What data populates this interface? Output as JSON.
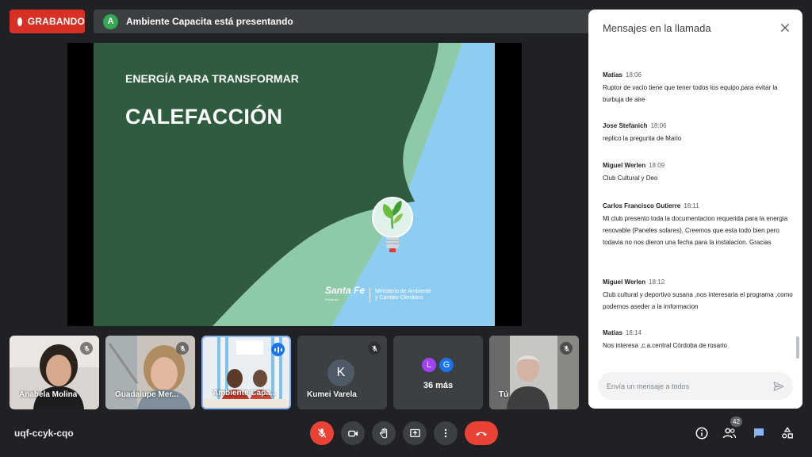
{
  "recording": {
    "label": "GRABANDO"
  },
  "presenting": {
    "avatar": "A",
    "text": "Ambiente Capacita está presentando",
    "avatar_color": "#34a853"
  },
  "slide": {
    "kicker": "ENERGÍA PARA TRANSFORMAR",
    "title": "CALEFACCIÓN",
    "brand": "Santa Fe",
    "brand_sub": "Provincia",
    "ministry_line1": "Ministerio de Ambiente",
    "ministry_line2": "y Cambio Climático",
    "colors": {
      "dark_green": "#2f5c3f",
      "mint": "#8fcaa8",
      "sky": "#8ecdf2"
    }
  },
  "tiles": [
    {
      "name": "Anabela Molina",
      "muted": true,
      "icon": "mic-off-icon"
    },
    {
      "name": "Guadalupe Mer...",
      "muted": true,
      "icon": "mic-off-icon"
    },
    {
      "name": "Ambiente Capa...",
      "speaking": true,
      "icon": "speaking-icon"
    },
    {
      "name": "Kumei Varela",
      "avatar": "K",
      "muted": true,
      "icon": "mic-off-icon"
    },
    {
      "more_label": "36 más",
      "avatars": [
        "L",
        "G"
      ],
      "avatar_colors": [
        "#a142f4",
        "#1a73e8"
      ]
    },
    {
      "name": "Tú",
      "muted": true,
      "icon": "mic-off-icon"
    }
  ],
  "chat": {
    "title": "Mensajes en la llamada",
    "messages": [
      {
        "sender": "Matias",
        "time": "18:06",
        "text": "Ruptor de vacio tiene que tener todos los equipo,para evitar la burbuja de aire"
      },
      {
        "sender": "Jose Stefanich",
        "time": "18:06",
        "text": "replico la pregunta de Mario"
      },
      {
        "sender": "Miguel Werlen",
        "time": "18:09",
        "text": "Club Cultural y Deo"
      },
      {
        "sender": "Carlos Francisco Gutierre",
        "time": "18:11",
        "text": "Mi club presento toda la documentacion requerida para la energia renovable (Paneles solares). Creemos que esta todo bien pero todavia no nos dieron una fecha para la instalacion. Gracias"
      },
      {
        "sender": "Miguel Werlen",
        "time": "18:12",
        "text": "Club cultural y  deportivo susana ,nos interesaria el programa ,como podemos  aseder a la  imformacion"
      },
      {
        "sender": "Matias",
        "time": "18:14",
        "text": "Nos interesa ,c.a.central Córdoba de rosario"
      }
    ],
    "input_placeholder": "Envía un mensaje a todos"
  },
  "meeting": {
    "code": "uqf-ccyk-cqo"
  },
  "controls": [
    "mic-off-icon",
    "camera-icon",
    "raise-hand-icon",
    "present-icon",
    "more-vert-icon",
    "hangup-icon"
  ],
  "right_controls": {
    "participants_count": "42",
    "icons": [
      "info-icon",
      "people-icon",
      "chat-icon",
      "activities-icon"
    ]
  }
}
